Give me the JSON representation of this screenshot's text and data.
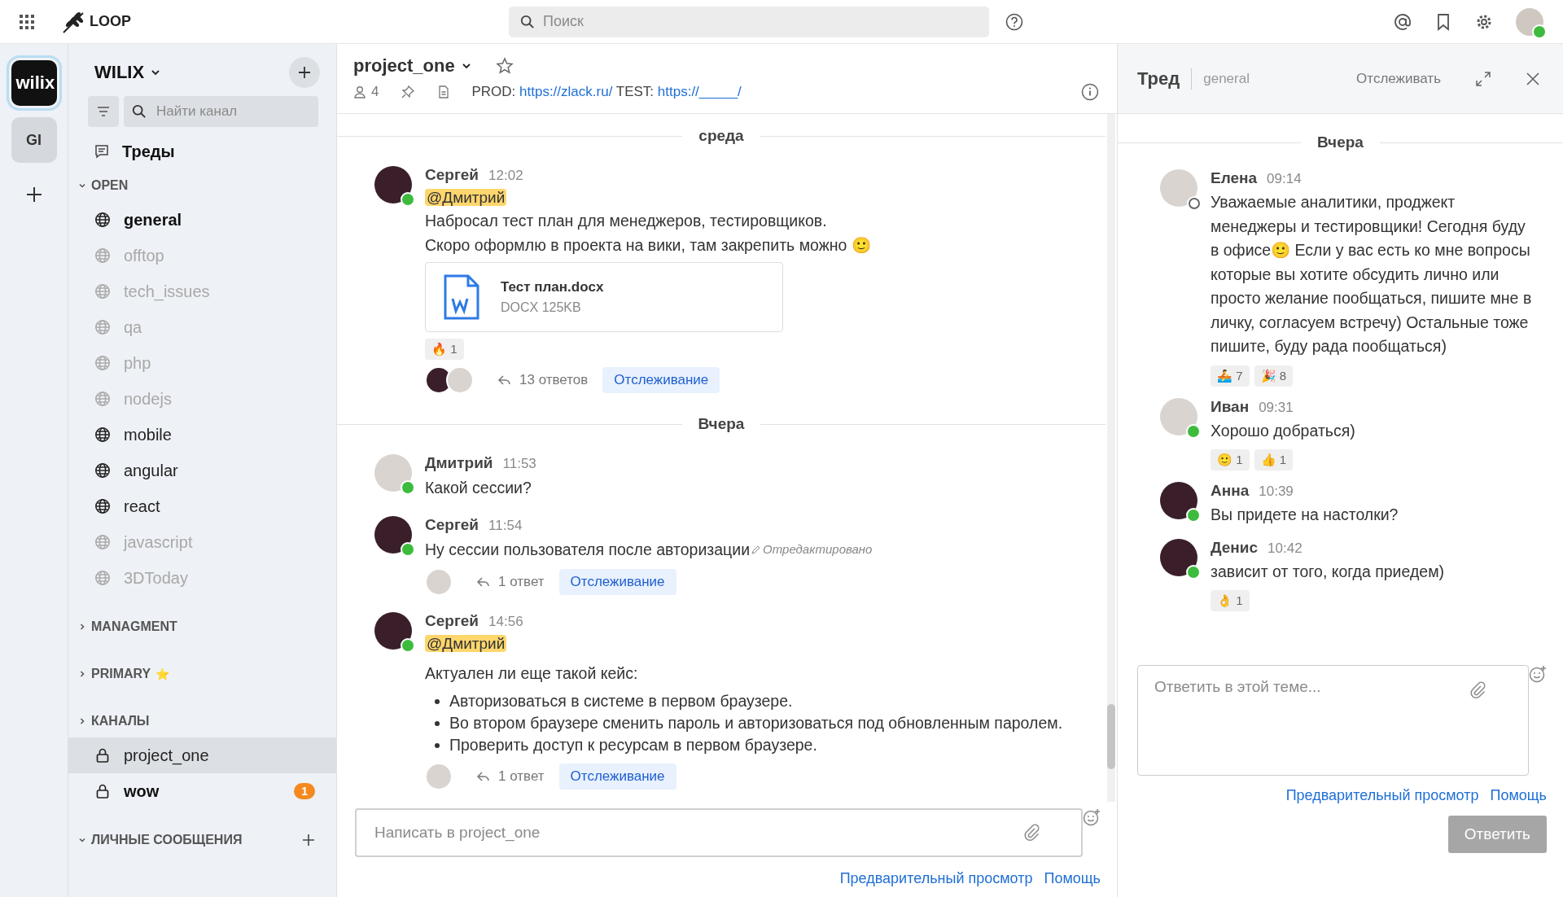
{
  "topbar": {
    "logo": "LOOP",
    "search": {
      "placeholder": "Поиск"
    }
  },
  "teams": [
    {
      "label": "wilix",
      "kind": "logo",
      "selected": true
    },
    {
      "label": "GI",
      "kind": "initials",
      "selected": false
    }
  ],
  "sidebar": {
    "team_name": "WILIX",
    "search": {
      "placeholder": "Найти канал"
    },
    "threads": "Треды",
    "sections": [
      {
        "title": "OPEN",
        "kind": "channels",
        "expanded": true,
        "channels": [
          {
            "name": "general",
            "kind": "public",
            "unread": true,
            "muted": false,
            "selected": false
          },
          {
            "name": "offtop",
            "kind": "public",
            "unread": false,
            "muted": true,
            "selected": false
          },
          {
            "name": "tech_issues",
            "kind": "public",
            "unread": false,
            "muted": true,
            "selected": false
          },
          {
            "name": "qa",
            "kind": "public",
            "unread": false,
            "muted": true,
            "selected": false
          },
          {
            "name": "php",
            "kind": "public",
            "unread": false,
            "muted": true,
            "selected": false
          },
          {
            "name": "nodejs",
            "kind": "public",
            "unread": false,
            "muted": true,
            "selected": false
          },
          {
            "name": "mobile",
            "kind": "public",
            "unread": false,
            "muted": false,
            "selected": false
          },
          {
            "name": "angular",
            "kind": "public",
            "unread": false,
            "muted": false,
            "selected": false
          },
          {
            "name": "react",
            "kind": "public",
            "unread": false,
            "muted": false,
            "selected": false
          },
          {
            "name": "javascript",
            "kind": "public",
            "unread": false,
            "muted": true,
            "selected": false
          },
          {
            "name": "3DToday",
            "kind": "public",
            "unread": false,
            "muted": true,
            "selected": false
          }
        ]
      },
      {
        "title": "MANAGMENT",
        "kind": "channels",
        "expanded": false
      },
      {
        "title": "PRIMARY",
        "emoji": "⭐",
        "kind": "channels",
        "expanded": false
      },
      {
        "title": "КАНАЛЫ",
        "kind": "channels",
        "expanded": false,
        "channels": [
          {
            "name": "project_one",
            "kind": "private",
            "unread": false,
            "muted": false,
            "selected": true
          },
          {
            "name": "wow",
            "kind": "private",
            "unread": true,
            "muted": false,
            "selected": false,
            "badge": "1"
          }
        ]
      },
      {
        "title": "ЛИЧНЫЕ СООБЩЕНИЯ",
        "kind": "direct",
        "expanded": true
      }
    ]
  },
  "center": {
    "channel": "project_one",
    "members": "4",
    "header": [
      {
        "kind": "text",
        "text": "PROD: "
      },
      {
        "kind": "link",
        "text": "https://zlack.ru/"
      },
      {
        "kind": "text",
        "text": " TEST: "
      },
      {
        "kind": "link",
        "text": "https://_____/"
      }
    ],
    "posts": [
      {
        "kind": "date",
        "label": "среда"
      },
      {
        "kind": "post",
        "author": "Сергей",
        "time": "12:02",
        "avatar": {
          "kind": "dark"
        },
        "online": true,
        "mention": "@Дмитрий",
        "lines": [
          "Набросал тест план для менеджеров, тестировщиков.",
          "Скоро оформлю в проекта на вики, там закрепить можно  🙂"
        ],
        "attachment": {
          "name": "Тест план.docx",
          "meta": "DOCX 125KB"
        },
        "reactions": [
          {
            "emoji": "🔥",
            "count": "1"
          }
        ],
        "thread": {
          "participants": [
            {
              "kind": "dark"
            },
            {
              "kind": "light"
            }
          ],
          "replies": "13 ответов",
          "follow": "Отслеживание"
        }
      },
      {
        "kind": "date",
        "label": "Вчера"
      },
      {
        "kind": "post",
        "author": "Дмитрий",
        "time": "11:53",
        "avatar": {
          "kind": "light"
        },
        "online": true,
        "lines": [
          "Какой сессии?"
        ]
      },
      {
        "kind": "post",
        "author": "Сергей",
        "time": "11:54",
        "avatar": {
          "kind": "dark"
        },
        "online": true,
        "lines": [
          "Ну сессии пользователя после авторизации"
        ],
        "edited": "Отредактировано",
        "thread": {
          "participants": [
            {
              "kind": "light"
            }
          ],
          "replies": "1 ответ",
          "follow": "Отслеживание"
        }
      },
      {
        "kind": "post",
        "author": "Сергей",
        "time": "14:56",
        "avatar": {
          "kind": "dark"
        },
        "online": true,
        "mention": "@Дмитрий",
        "lines": [
          "Актуален ли еще такой кейс:"
        ],
        "bullets": [
          "Авторизоваться в системе в первом браузере.",
          "Во втором браузере сменить пароль и авторизоваться под обновленным паролем.",
          "Проверить доступ к ресурсам в первом браузере."
        ],
        "thread": {
          "participants": [
            {
              "kind": "light"
            }
          ],
          "replies": "1 ответ",
          "follow": "Отслеживание"
        }
      }
    ],
    "composer": {
      "placeholder": "Написать в project_one"
    },
    "links": [
      "Предварительный просмотр",
      "Помощь"
    ]
  },
  "thread": {
    "title": "Тред",
    "channel": "general",
    "follow": "Отслеживать",
    "date": "Вчера",
    "posts": [
      {
        "author": "Елена",
        "time": "09:14",
        "avatar": {
          "kind": "light"
        },
        "online": false,
        "text": "Уважаемые аналитики, проджект менеджеры и тестировщики! Сегодня буду в офисе🙂 Если у вас есть ко мне вопросы которые вы хотите обсудить лично или просто желание пообщаться, пишите мне в личку, согласуем встречу) Остальные тоже пишите, буду рада пообщаться)",
        "reactions": [
          {
            "emoji": "🚣",
            "count": "7"
          },
          {
            "emoji": "🎉",
            "count": "8"
          }
        ]
      },
      {
        "author": "Иван",
        "time": "09:31",
        "avatar": {
          "kind": "light"
        },
        "online": true,
        "text": "Хорошо добраться)",
        "reactions": [
          {
            "emoji": "🙂",
            "count": "1"
          },
          {
            "emoji": "👍",
            "count": "1"
          }
        ]
      },
      {
        "author": "Анна",
        "time": "10:39",
        "avatar": {
          "kind": "dark"
        },
        "online": true,
        "text": "Вы придете на настолки?"
      },
      {
        "author": "Денис",
        "time": "10:42",
        "avatar": {
          "kind": "dark"
        },
        "online": true,
        "text": "зависит от того, когда приедем)",
        "reactions": [
          {
            "emoji": "👌",
            "count": "1"
          }
        ]
      }
    ],
    "reply": {
      "placeholder": "Ответить в этой теме..."
    },
    "links": [
      "Предварительный просмотр",
      "Помощь"
    ],
    "button": {
      "label": "Ответить",
      "disabled": true
    }
  }
}
